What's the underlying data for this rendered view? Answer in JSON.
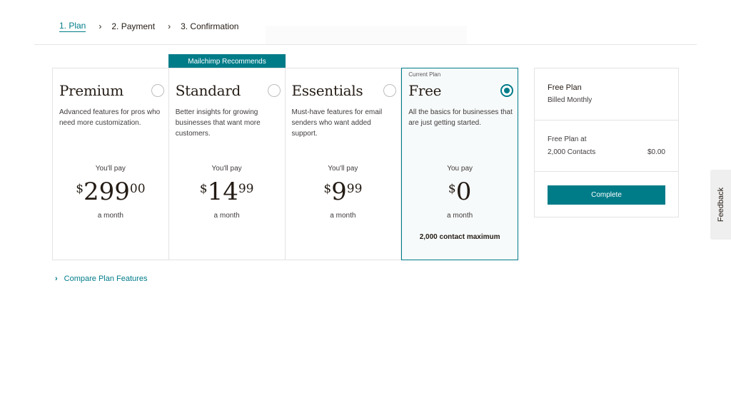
{
  "stepper": {
    "steps": [
      {
        "label": "1. Plan"
      },
      {
        "label": "2. Payment"
      },
      {
        "label": "3. Confirmation"
      }
    ],
    "separator": "›"
  },
  "recommend_banner": "Mailchimp Recommends",
  "plans": [
    {
      "name": "Premium",
      "description": "Advanced features for pros who need more customization.",
      "pay_label": "You'll pay",
      "currency": "$",
      "price_whole": "299",
      "price_cents": "00",
      "period": "a month",
      "selected": false
    },
    {
      "name": "Standard",
      "description": "Better insights for growing businesses that want more customers.",
      "pay_label": "You'll pay",
      "currency": "$",
      "price_whole": "14",
      "price_cents": "99",
      "period": "a month",
      "selected": false
    },
    {
      "name": "Essentials",
      "description": "Must-have features for email senders who want added support.",
      "pay_label": "You'll pay",
      "currency": "$",
      "price_whole": "9",
      "price_cents": "99",
      "period": "a month",
      "selected": false
    },
    {
      "name": "Free",
      "tag": "Current Plan",
      "description": "All the basics for businesses that are just getting started.",
      "pay_label": "You pay",
      "currency": "$",
      "price_whole": "0",
      "price_cents": "",
      "period": "a month",
      "limit": "2,000 contact maximum",
      "selected": true
    }
  ],
  "compare_link": {
    "arrow": "›",
    "label": "Compare Plan Features"
  },
  "summary": {
    "title": "Free Plan",
    "billing": "Billed Monthly",
    "line1": "Free Plan at",
    "line2": "2,000 Contacts",
    "amount": "$0.00",
    "button": "Complete"
  },
  "feedback_tab": "Feedback",
  "colors": {
    "accent": "#007c89",
    "text": "#241c15",
    "border": "#e3e3e3"
  }
}
